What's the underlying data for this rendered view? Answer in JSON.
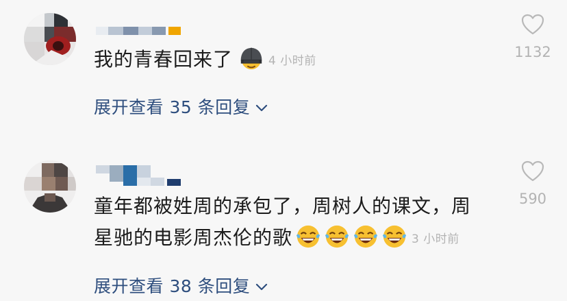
{
  "comments": [
    {
      "text": "我的青春回来了",
      "time": "4 小时前",
      "likes": "1132",
      "expand": "展开查看 35 条回复",
      "emoji": "helmet-face-emoji"
    },
    {
      "text_line1": "童年都被姓周的承包了，周树人的课文，周",
      "text_line2": "星驰的电影周杰伦的歌",
      "time": "3 小时前",
      "likes": "590",
      "expand": "展开查看 38 条回复",
      "emoji": "tears-of-joy-emoji"
    }
  ],
  "colors": {
    "background": "#f7f7f7",
    "text": "#1c1c1c",
    "link": "#2e4e7e",
    "muted": "#b3b3b3"
  }
}
